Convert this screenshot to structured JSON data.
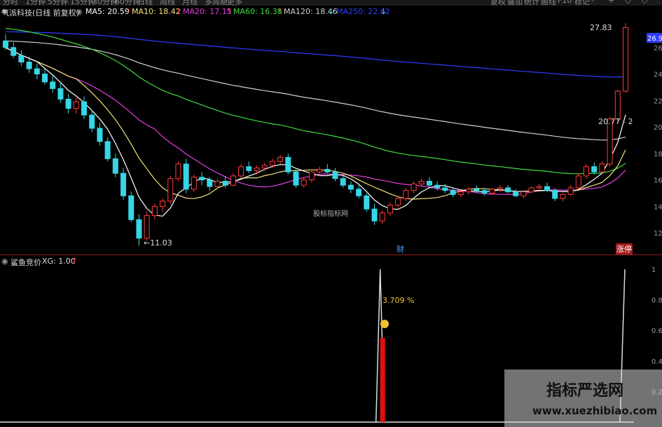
{
  "toolbar": {
    "left_items": [
      "分时",
      "1分钟",
      "5分钟",
      "15分钟",
      "30分钟",
      "60分钟",
      "日线",
      "周线",
      "月线",
      "多周期",
      "更多"
    ],
    "right_items": [
      "复权",
      "叠加",
      "统计",
      "画线",
      "F10",
      "标记",
      "-",
      "+",
      "◇",
      "◇"
    ]
  },
  "upper_legend": {
    "name": "气派科技(日线 前复权)",
    "ma5": {
      "label": "MA5: 20.59",
      "arrow": "↑",
      "color": "#ffffff"
    },
    "ma10": {
      "label": "MA10: 18.42",
      "arrow": "↑",
      "color": "#f5e17a"
    },
    "ma20": {
      "label": "MA20: 17.15",
      "arrow": "↑",
      "color": "#e040e0"
    },
    "ma60": {
      "label": "MA60: 16.38",
      "arrow": "↑",
      "color": "#3ddc3d"
    },
    "ma120": {
      "label": "MA120: 18.46",
      "arrow": "↓",
      "color": "#d0d0d0"
    },
    "ma250": {
      "label": "MA250: 22.62",
      "arrow": "↓",
      "color": "#2f3cff"
    }
  },
  "annotations": {
    "low": "←11.03",
    "high": "27.83",
    "mid": "20.77 - 2",
    "center_watermark": "股标指标网",
    "cai": "财",
    "zhangting": "涨停",
    "pct": "3.709",
    "pct_sign": "%"
  },
  "right_axis": {
    "current_price": "26.90",
    "ticks": [
      "26",
      "24",
      "22",
      "20",
      "18",
      "16",
      "14",
      "12"
    ],
    "lower_ticks": [
      "1",
      "0.8",
      "0.6",
      "0.4",
      "0.2"
    ]
  },
  "lower_legend": {
    "name": "鲨鱼竞价",
    "xg": "XG: 1.00",
    "arrow": "↑"
  },
  "watermark": {
    "cn": "指标严选网",
    "url": "www.xuezhibiao.com"
  },
  "colors": {
    "up": "#ff3b3b",
    "down": "#35d6e6",
    "background": "#000000",
    "signal_bar": "#e01010"
  },
  "chart_data": {
    "type": "candlestick",
    "series": [
      {
        "name": "MA5",
        "values_note": "follows close"
      },
      {
        "name": "MA10"
      },
      {
        "name": "MA20"
      },
      {
        "name": "MA60"
      },
      {
        "name": "MA120"
      },
      {
        "name": "MA250"
      }
    ],
    "price_range": [
      11,
      28
    ],
    "ohlc": [
      [
        26.5,
        27.0,
        25.8,
        26.0
      ],
      [
        26.0,
        26.4,
        25.2,
        25.4
      ],
      [
        25.4,
        25.8,
        24.6,
        24.9
      ],
      [
        24.9,
        25.3,
        24.1,
        24.4
      ],
      [
        24.4,
        24.8,
        23.6,
        24.0
      ],
      [
        24.0,
        24.4,
        23.2,
        23.4
      ],
      [
        23.4,
        23.9,
        22.6,
        22.9
      ],
      [
        22.9,
        23.3,
        21.8,
        22.1
      ],
      [
        22.1,
        22.5,
        21.0,
        21.4
      ],
      [
        21.4,
        22.2,
        21.0,
        21.9
      ],
      [
        21.9,
        22.3,
        20.6,
        20.9
      ],
      [
        20.9,
        21.3,
        19.6,
        19.9
      ],
      [
        19.9,
        20.3,
        18.6,
        18.9
      ],
      [
        18.9,
        19.2,
        17.4,
        17.6
      ],
      [
        17.6,
        18.0,
        16.2,
        16.5
      ],
      [
        16.5,
        16.9,
        14.5,
        14.8
      ],
      [
        14.8,
        15.1,
        12.8,
        13.0
      ],
      [
        13.0,
        13.4,
        11.03,
        11.6
      ],
      [
        11.6,
        13.6,
        11.4,
        13.3
      ],
      [
        13.3,
        14.2,
        13.0,
        14.0
      ],
      [
        14.0,
        14.6,
        13.6,
        14.4
      ],
      [
        14.4,
        16.3,
        14.2,
        16.1
      ],
      [
        16.1,
        17.4,
        15.9,
        17.2
      ],
      [
        17.2,
        17.6,
        15.0,
        15.3
      ],
      [
        15.3,
        16.4,
        15.1,
        16.2
      ],
      [
        16.2,
        16.6,
        15.6,
        16.0
      ],
      [
        16.0,
        16.2,
        15.2,
        15.5
      ],
      [
        15.5,
        16.1,
        15.3,
        15.9
      ],
      [
        15.9,
        16.3,
        15.4,
        15.6
      ],
      [
        15.6,
        16.5,
        15.5,
        16.3
      ],
      [
        16.3,
        17.2,
        16.1,
        17.0
      ],
      [
        17.0,
        17.4,
        16.5,
        16.7
      ],
      [
        16.7,
        17.1,
        16.4,
        16.9
      ],
      [
        16.9,
        17.3,
        16.7,
        17.1
      ],
      [
        17.1,
        17.6,
        16.9,
        17.4
      ],
      [
        17.4,
        17.9,
        17.2,
        17.7
      ],
      [
        17.7,
        18.0,
        16.4,
        16.6
      ],
      [
        16.6,
        16.9,
        15.4,
        15.6
      ],
      [
        15.6,
        16.2,
        15.4,
        16.0
      ],
      [
        16.0,
        16.8,
        15.8,
        16.6
      ],
      [
        16.6,
        17.0,
        16.3,
        16.8
      ],
      [
        16.8,
        17.2,
        16.5,
        16.6
      ],
      [
        16.6,
        16.9,
        15.9,
        16.1
      ],
      [
        16.1,
        16.3,
        15.4,
        15.6
      ],
      [
        15.6,
        15.9,
        15.0,
        15.3
      ],
      [
        15.3,
        15.6,
        14.6,
        14.8
      ],
      [
        14.8,
        15.0,
        13.6,
        13.8
      ],
      [
        13.8,
        14.2,
        12.6,
        12.9
      ],
      [
        12.9,
        13.7,
        12.7,
        13.5
      ],
      [
        13.5,
        14.3,
        13.3,
        14.1
      ],
      [
        14.1,
        14.8,
        13.9,
        14.6
      ],
      [
        14.6,
        15.4,
        14.4,
        15.2
      ],
      [
        15.2,
        15.9,
        15.0,
        15.7
      ],
      [
        15.7,
        16.1,
        15.5,
        15.9
      ],
      [
        15.9,
        16.2,
        15.4,
        15.6
      ],
      [
        15.6,
        15.9,
        15.2,
        15.4
      ],
      [
        15.4,
        15.7,
        15.0,
        15.2
      ],
      [
        15.2,
        15.4,
        14.7,
        14.9
      ],
      [
        14.9,
        15.3,
        14.7,
        15.1
      ],
      [
        15.1,
        15.5,
        14.9,
        15.3
      ],
      [
        15.3,
        15.6,
        15.0,
        15.2
      ],
      [
        15.2,
        15.4,
        14.8,
        15.0
      ],
      [
        15.0,
        15.4,
        14.9,
        15.3
      ],
      [
        15.3,
        15.6,
        15.1,
        15.4
      ],
      [
        15.4,
        15.6,
        15.0,
        15.1
      ],
      [
        15.1,
        15.3,
        14.7,
        14.8
      ],
      [
        14.8,
        15.2,
        14.6,
        15.1
      ],
      [
        15.1,
        15.5,
        15.0,
        15.4
      ],
      [
        15.4,
        15.7,
        15.2,
        15.5
      ],
      [
        15.5,
        15.8,
        15.1,
        15.2
      ],
      [
        15.2,
        15.4,
        14.4,
        14.6
      ],
      [
        14.6,
        15.0,
        14.4,
        14.9
      ],
      [
        14.9,
        15.6,
        14.8,
        15.4
      ],
      [
        15.4,
        16.5,
        15.3,
        16.3
      ],
      [
        16.3,
        17.2,
        16.1,
        17.0
      ],
      [
        17.0,
        17.3,
        16.4,
        16.6
      ],
      [
        16.6,
        17.4,
        16.5,
        17.2
      ],
      [
        17.2,
        20.77,
        17.0,
        20.6
      ],
      [
        20.6,
        22.8,
        20.4,
        22.7
      ],
      [
        22.7,
        27.83,
        22.6,
        27.5
      ]
    ],
    "signal": {
      "name": "XG",
      "values": [
        1,
        1
      ],
      "highlight_bar": 0.55,
      "pct": 3.709
    },
    "low_label": 11.03,
    "high_label": 27.83
  }
}
